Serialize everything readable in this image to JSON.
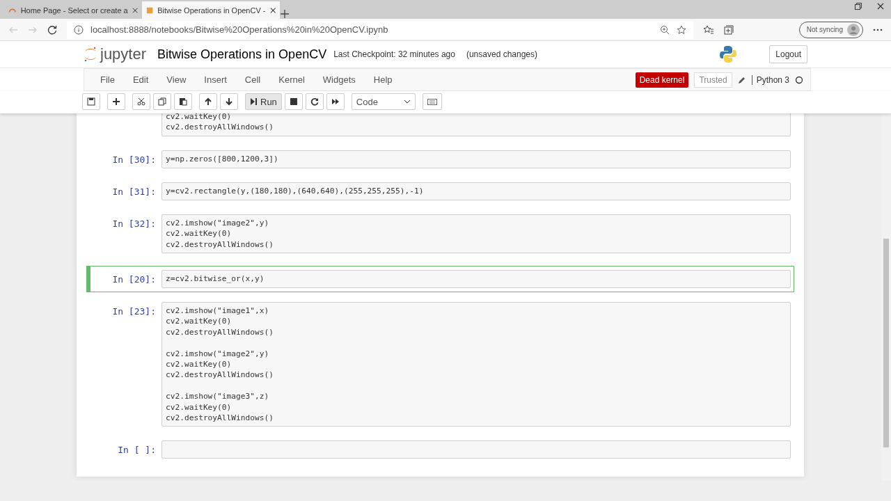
{
  "browser": {
    "tabs": [
      {
        "title": "Home Page - Select or create a",
        "selected": false
      },
      {
        "title": "Bitwise Operations in OpenCV -",
        "selected": true
      }
    ],
    "address": "localhost:8888/notebooks/Bitwise%20Operations%20in%20OpenCV.ipynb",
    "profile": "Not syncing"
  },
  "header": {
    "logo": "jupyter",
    "title": "Bitwise Operations in OpenCV",
    "checkpoint": "Last Checkpoint: 32 minutes ago",
    "status": "(unsaved changes)",
    "logout": "Logout"
  },
  "menu": [
    "File",
    "Edit",
    "View",
    "Insert",
    "Cell",
    "Kernel",
    "Widgets",
    "Help"
  ],
  "kernel": {
    "dead": "Dead kernel",
    "trusted": "Trusted",
    "name": "Python 3"
  },
  "toolbar": [
    {
      "kind": "save"
    },
    {
      "kind": "add"
    },
    {
      "kind": "cut"
    },
    {
      "kind": "copy"
    },
    {
      "kind": "paste"
    },
    {
      "kind": "up"
    },
    {
      "kind": "down"
    },
    {
      "kind": "run",
      "label": "Run"
    },
    {
      "kind": "stop"
    },
    {
      "kind": "restart"
    },
    {
      "kind": "fastforward"
    },
    {
      "kind": "select",
      "label": "Code"
    },
    {
      "kind": "keyboard"
    }
  ],
  "cells": [
    {
      "selected": false,
      "blocks": [
        [
          "cv2.waitKey(0)",
          "cv2.destroyAllWindows()"
        ]
      ]
    },
    {
      "prompt": "In [30]:",
      "selected": false,
      "blocks": [
        [
          "y=np.zeros([800,1200,3])"
        ]
      ]
    },
    {
      "prompt": "In [31]:",
      "selected": false,
      "blocks": [
        [
          "y=cv2.rectangle(y,(180,180),(640,640),(255,255,255),-1)"
        ]
      ]
    },
    {
      "prompt": "In [32]:",
      "selected": false,
      "blocks": [
        [
          "cv2.imshow(\"image2\",y)",
          "cv2.waitKey(0)",
          "cv2.destroyAllWindows()"
        ]
      ]
    },
    {
      "prompt": "In [20]:",
      "selected": true,
      "blocks": [
        [
          "z=cv2.bitwise_or(x,y)"
        ]
      ]
    },
    {
      "prompt": "In [23]:",
      "selected": false,
      "blocks": [
        [
          "cv2.imshow(\"image1\",x)",
          "cv2.waitKey(0)",
          "cv2.destroyAllWindows()"
        ],
        [
          "cv2.imshow(\"image2\",y)",
          "cv2.waitKey(0)",
          "cv2.destroyAllWindows()"
        ],
        [
          "cv2.imshow(\"image3\",z)",
          "cv2.waitKey(0)",
          "cv2.destroyAllWindows()"
        ]
      ]
    },
    {
      "prompt": "In [ ]:",
      "selected": false
    }
  ]
}
